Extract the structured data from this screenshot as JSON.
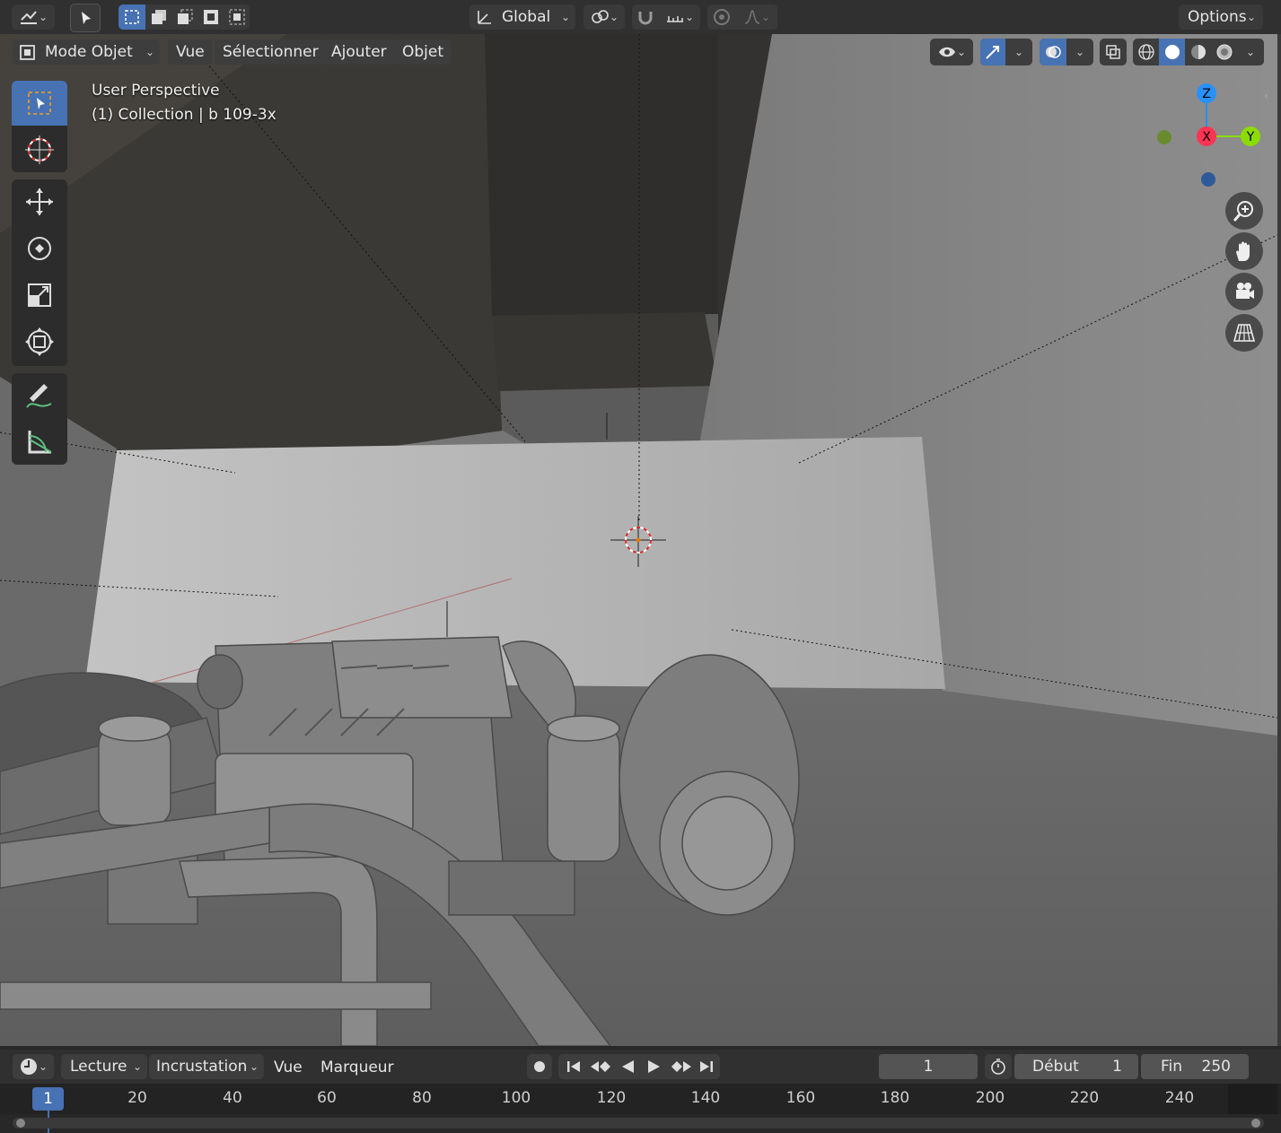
{
  "header": {
    "transform_orientation": "Global",
    "options_label": "Options"
  },
  "viewport_header": {
    "mode_label": "Mode Objet",
    "menus": [
      "Vue",
      "Sélectionner",
      "Ajouter",
      "Objet"
    ]
  },
  "viewport": {
    "perspective_label": "User Perspective",
    "collection_label": "(1) Collection | b 109-3x",
    "gizmo_axes": {
      "z": "Z",
      "x": "X",
      "y": "Y"
    }
  },
  "toolbar": {
    "tools": [
      "select-box",
      "cursor",
      "move",
      "rotate",
      "scale",
      "transform",
      "annotate",
      "measure"
    ]
  },
  "timeline": {
    "menus": [
      "Lecture",
      "Incrustation",
      "Vue",
      "Marqueur"
    ],
    "current_frame": "1",
    "start_label": "Début",
    "start_value": "1",
    "end_label": "Fin",
    "end_value": "250",
    "playhead_frame": "1",
    "ticks": [
      "20",
      "40",
      "60",
      "80",
      "100",
      "120",
      "140",
      "160",
      "180",
      "200",
      "220",
      "240"
    ]
  },
  "colors": {
    "accent": "#4772b3",
    "axis_x": "#ff3352",
    "axis_y": "#8bdc00",
    "axis_z": "#2890ff"
  }
}
